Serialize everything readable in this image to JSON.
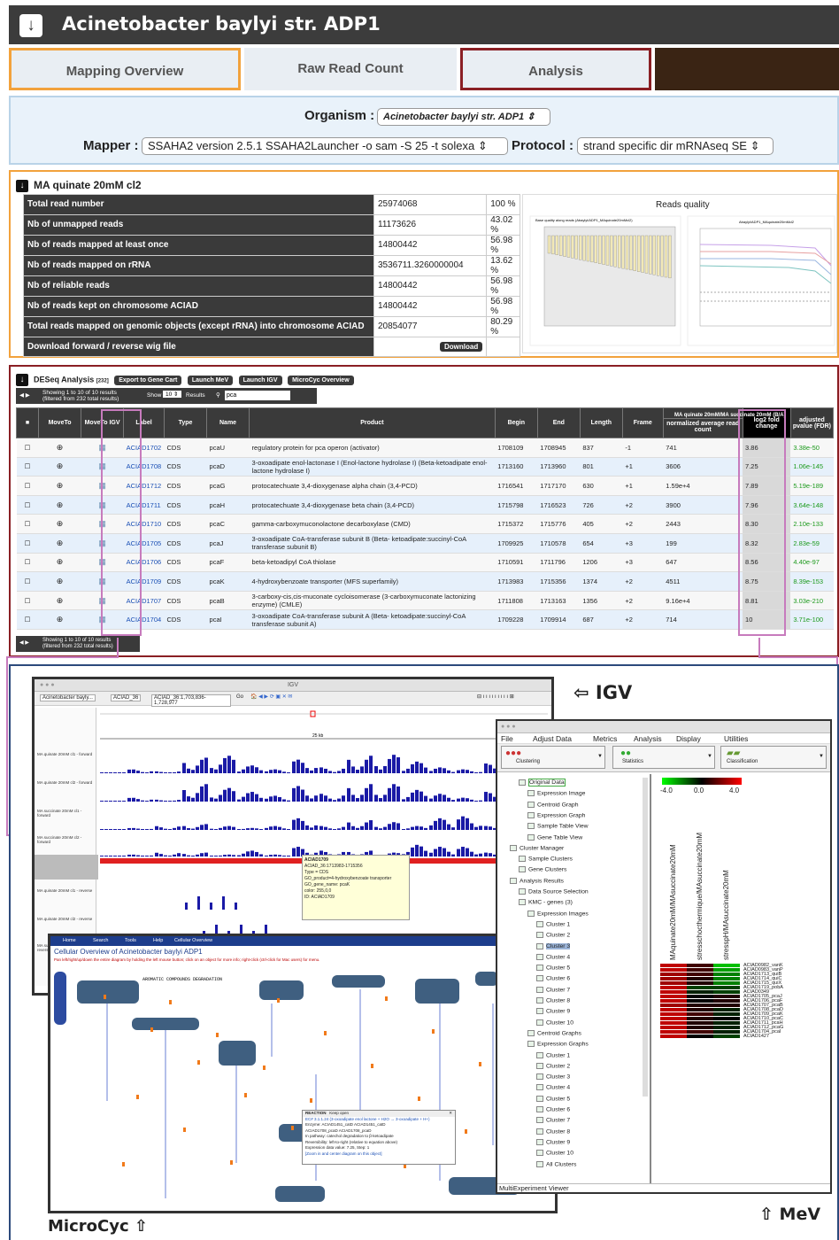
{
  "header": {
    "title": "Acinetobacter baylyi str. ADP1",
    "collapse_icon": "arrow-down-icon"
  },
  "tabs": [
    {
      "label": "Mapping Overview"
    },
    {
      "label": "Raw Read Count"
    },
    {
      "label": "Analysis"
    }
  ],
  "organism": {
    "label": "Organism :",
    "value": "Acinetobacter baylyi str. ADP1"
  },
  "mapper": {
    "label": "Mapper :",
    "value": "SSAHA2 version 2.5.1 SSAHA2Launcher -o sam -S 25 -t solexa"
  },
  "protocol": {
    "label": "Protocol :",
    "value": "strand specific dir mRNAseq SE"
  },
  "stats": {
    "title": "MA quinate 20mM cl2",
    "rows": [
      {
        "k": "Total read number",
        "v": "25974068",
        "p": "100 %"
      },
      {
        "k": "Nb of unmapped reads",
        "v": "11173626",
        "p": "43.02 %"
      },
      {
        "k": "Nb of reads mapped at least once",
        "v": "14800442",
        "p": "56.98 %"
      },
      {
        "k": "Nb of reads mapped on rRNA",
        "v": "3536711.3260000004",
        "p": "13.62 %"
      },
      {
        "k": "Nb of reliable reads",
        "v": "14800442",
        "p": "56.98 %"
      },
      {
        "k": "Nb of reads kept on chromosome ACIAD",
        "v": "14800442",
        "p": "56.98 %"
      },
      {
        "k": "Total reads mapped on genomic objects (except rRNA) into chromosome ACIAD",
        "v": "20854077",
        "p": "80.29 %"
      },
      {
        "k": "Download forward / reverse wig file",
        "v": "",
        "p": ""
      }
    ],
    "download_label": "Download",
    "quality_title": "Reads quality",
    "plot1_title": "Base quality along reads (Abaylyi/ADP1_MAquinate20mMcl2)",
    "plot2_title": "Abaylyi/ADP1_MAquinate20mMcl2"
  },
  "deseq": {
    "title": "DESeq Analysis",
    "count": "[232]",
    "buttons": [
      "Export to Gene Cart",
      "Launch MeV",
      "Launch IGV",
      "MicroCyc Overview"
    ],
    "showing": "Showing 1 to 10 of 10 results",
    "filtered": "(filtered from 232 total results)",
    "show_label": "Show",
    "show_value": "10",
    "results_label": "Results",
    "search_value": "pca",
    "comparison": "MA quinate 20mM/MA succinate 20mM (B/A)",
    "columns": [
      "MoveTo",
      "MoveTo IGV",
      "Label",
      "Type",
      "Name",
      "Product",
      "Begin",
      "End",
      "Length",
      "Frame",
      "normalized average read count",
      "log2 fold change",
      "adjusted pvalue (FDR)"
    ],
    "rows": [
      {
        "label": "ACIAD1702",
        "type": "CDS",
        "name": "pcaU",
        "product": "regulatory protein for pca operon (activator)",
        "begin": "1708109",
        "end": "1708945",
        "length": "837",
        "frame": "-1",
        "count": "741",
        "fc": "3.86",
        "p": "3.38e-50"
      },
      {
        "label": "ACIAD1708",
        "type": "CDS",
        "name": "pcaD",
        "product": "3-oxoadipate enol-lactonase I (Enol-lactone hydrolase I) (Beta-ketoadipate enol-lactone hydrolase I)",
        "begin": "1713160",
        "end": "1713960",
        "length": "801",
        "frame": "+1",
        "count": "3606",
        "fc": "7.25",
        "p": "1.06e-145"
      },
      {
        "label": "ACIAD1712",
        "type": "CDS",
        "name": "pcaG",
        "product": "protocatechuate 3,4-dioxygenase alpha chain (3,4-PCD)",
        "begin": "1716541",
        "end": "1717170",
        "length": "630",
        "frame": "+1",
        "count": "1.59e+4",
        "fc": "7.89",
        "p": "5.19e-189"
      },
      {
        "label": "ACIAD1711",
        "type": "CDS",
        "name": "pcaH",
        "product": "protocatechuate 3,4-dioxygenase beta chain (3,4-PCD)",
        "begin": "1715798",
        "end": "1716523",
        "length": "726",
        "frame": "+2",
        "count": "3900",
        "fc": "7.96",
        "p": "3.64e-148"
      },
      {
        "label": "ACIAD1710",
        "type": "CDS",
        "name": "pcaC",
        "product": "gamma-carboxymuconolactone decarboxylase (CMD)",
        "begin": "1715372",
        "end": "1715776",
        "length": "405",
        "frame": "+2",
        "count": "2443",
        "fc": "8.30",
        "p": "2.10e-133"
      },
      {
        "label": "ACIAD1705",
        "type": "CDS",
        "name": "pcaJ",
        "product": "3-oxoadipate CoA-transferase subunit B (Beta- ketoadipate:succinyl-CoA transferase subunit B)",
        "begin": "1709925",
        "end": "1710578",
        "length": "654",
        "frame": "+3",
        "count": "199",
        "fc": "8.32",
        "p": "2.83e-59"
      },
      {
        "label": "ACIAD1706",
        "type": "CDS",
        "name": "pcaF",
        "product": "beta-ketoadipyl CoA thiolase",
        "begin": "1710591",
        "end": "1711796",
        "length": "1206",
        "frame": "+3",
        "count": "647",
        "fc": "8.56",
        "p": "4.40e-97"
      },
      {
        "label": "ACIAD1709",
        "type": "CDS",
        "name": "pcaK",
        "product": "4-hydroxybenzoate transporter (MFS superfamily)",
        "begin": "1713983",
        "end": "1715356",
        "length": "1374",
        "frame": "+2",
        "count": "4511",
        "fc": "8.75",
        "p": "8.39e-153"
      },
      {
        "label": "ACIAD1707",
        "type": "CDS",
        "name": "pcaB",
        "product": "3-carboxy-cis,cis-muconate cycloisomerase (3-carboxymuconate lactonizing enzyme) (CMLE)",
        "begin": "1711808",
        "end": "1713163",
        "length": "1356",
        "frame": "+2",
        "count": "9.16e+4",
        "fc": "8.81",
        "p": "3.03e-210"
      },
      {
        "label": "ACIAD1704",
        "type": "CDS",
        "name": "pcaI",
        "product": "3-oxoadipate CoA-transferase subunit A (Beta- ketoadipate:succinyl-CoA transferase subunit A)",
        "begin": "1709228",
        "end": "1709914",
        "length": "687",
        "frame": "+2",
        "count": "714",
        "fc": "10",
        "p": "3.71e-100"
      }
    ]
  },
  "igv": {
    "title": "IGV",
    "label": "⇦  IGV",
    "genome": "Acinetobacter bayly...",
    "chrom": "ACIAD_36",
    "locus": "ACIAD_36:1,703,836-1,728,977",
    "go": "Go",
    "scale": "25 kb",
    "tracks": [
      "MA quinate 20mM cl1 - forward",
      "MA quinate 20mM cl2 - forward",
      "MA succinate 20mM cl1 - forward",
      "MA succinate 20mM cl2 - forward",
      "Gene",
      "MA quinate 20mM cl1 - reverse",
      "MA quinate 20mM cl2 - reverse",
      "MA succinate 20mM cl1 - reverse"
    ],
    "popup": [
      "ACIAD1709",
      "ACIAD_36:1713983-1715356",
      "Type = CDS",
      "GO_product=4-hydroxybenzoate transporter",
      "GO_gene_name: pcaK",
      "color: 255,0,0",
      "ID: ACIAD1709"
    ]
  },
  "mev": {
    "label": "⇧ MeV",
    "menu": [
      "File",
      "Adjust Data",
      "Metrics",
      "Analysis",
      "Display",
      "Utilities"
    ],
    "tools": [
      "Clustering",
      "Statistics",
      "Classification"
    ],
    "tree": [
      "Original Data",
      "Expression Image",
      "Centroid Graph",
      "Expression Graph",
      "Sample Table View",
      "Gene Table View",
      "Cluster Manager",
      "Sample Clusters",
      "Gene Clusters",
      "Analysis Results",
      "Data Source Selection",
      "KMC - genes (3)",
      "Expression Images",
      "Cluster 1",
      "Cluster 2",
      "Cluster 3",
      "Cluster 4",
      "Cluster 5",
      "Cluster 6",
      "Cluster 7",
      "Cluster 8",
      "Cluster 9",
      "Cluster 10",
      "Centroid Graphs",
      "Expression Graphs",
      "Cluster 1",
      "Cluster 2",
      "Cluster 3",
      "Cluster 4",
      "Cluster 5",
      "Cluster 6",
      "Cluster 7",
      "Cluster 8",
      "Cluster 9",
      "Cluster 10",
      "All Clusters"
    ],
    "scale": [
      "-4.0",
      "0.0",
      "4.0"
    ],
    "samples": [
      "MAquinate20mM/MAsuccinate20mM",
      "stresschocthermique/MAsuccinate20mM",
      "stresspH/MAsuccinate20mM"
    ],
    "genes": [
      "ACIAD0982_vanK",
      "ACIAD0983_vanP",
      "ACIAD1713_quiB",
      "ACIAD1714_quiC",
      "ACIAD1715_quiX",
      "ACIAD1719_pobA",
      "ACIAD0349",
      "ACIAD1705_pcaJ",
      "ACIAD1706_pcaF",
      "ACIAD1707_pcaB",
      "ACIAD1708_pcaD",
      "ACIAD1709_pcaK",
      "ACIAD1710_pcaC",
      "ACIAD1711_pcaH",
      "ACIAD1712_pcaG",
      "ACIAD1704_pcaI",
      "ACIAD1427"
    ],
    "footer": "MultiExperiment Viewer"
  },
  "microcyc": {
    "label": "MicroCyc ⇧",
    "nav": [
      "Home",
      "Search",
      "Tools",
      "Help",
      "Cellular Overview"
    ],
    "title": "Cellular Overview of Acinetobacter baylyi ADP1",
    "hint": "Pan left/right/up/down the entire diagram by holding the left mouse button; click on an object for more info; right-click (ctrl-click for Mac users) for menu.",
    "section": "AROMATIC COMPOUNDS DEGRADATION",
    "popup_title": "REACTION",
    "popup_keep": "Keep open",
    "popup_lines": [
      "EC# 3.1.1.24 (3-oxoadipate enol lactone + H2O → 3-oxoadipate + H+)",
      "Enzyme: ACIAD1451_catD ACIAD1451_catD",
      "ACIAD1708_pcaD ACIAD1708_pcaD",
      "In pathway: catechol degradation to β-ketoadipate",
      "Reversibility: left-to-right (relative to equation above)",
      "Expression data value: 7.25, Step: 1",
      "[Zoom in and center diagram on this object]"
    ]
  },
  "colors": {
    "orange": "#f2a23c",
    "darkred": "#8a1f24",
    "navy": "#2c4a7c",
    "pink": "#c77bbd"
  }
}
